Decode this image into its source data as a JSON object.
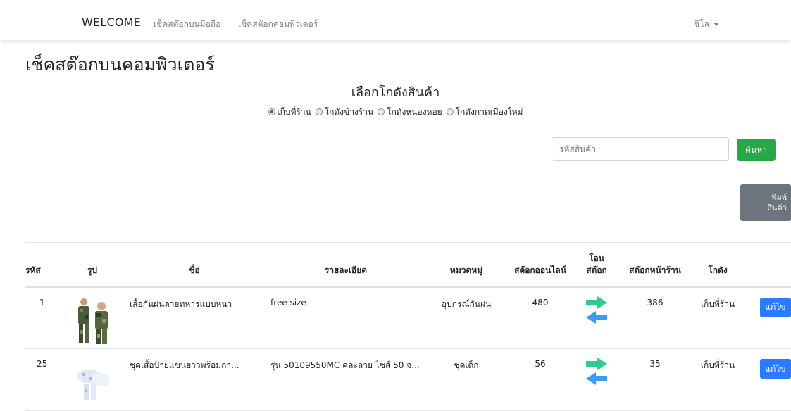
{
  "navbar": {
    "brand": "WELCOME",
    "links": [
      "เช็คสต๊อกบนมือถือ",
      "เช็คสต๊อกคอมพิวเตอร์"
    ],
    "user": "ชิโล"
  },
  "page": {
    "title": "เช็คสต๊อกบนคอมพิวเตอร์",
    "warehouse_heading": "เลือกโกดังสินค้า",
    "warehouses": [
      {
        "label": "เก็บที่ร้าน",
        "checked": true
      },
      {
        "label": "โกดังข้างร้าน",
        "checked": false
      },
      {
        "label": "โกดังหนองหอย",
        "checked": false
      },
      {
        "label": "โกดังกาดเมืองใหม่",
        "checked": false
      }
    ]
  },
  "search": {
    "placeholder": "รหัสสินค้า",
    "button": "ค้นหา"
  },
  "print": {
    "line1": "พิมพ์",
    "line2": "สินค้า"
  },
  "table": {
    "headers": {
      "code": "รหัส",
      "image": "รูป",
      "name": "ชื่อ",
      "detail": "รายละเอียด",
      "category": "หมวดหมู่",
      "online_stock": "สต๊อกออนไลน์",
      "transfer_line1": "โอน",
      "transfer_line2": "สต๊อก",
      "shop_stock": "สต๊อกหน้าร้าน",
      "warehouse": "โกดัง"
    },
    "rows": [
      {
        "code": "1",
        "image_icon": "camouflage-jacket-photo",
        "name": "เสื้อกันฝนลายทหารแบบหนา",
        "detail": "free size",
        "category": "อุปกรณ์กันฝน",
        "online_stock": "480",
        "shop_stock": "386",
        "warehouse": "เก็บที่ร้าน",
        "edit": "แก้ไข"
      },
      {
        "code": "25",
        "image_icon": "baby-clothes-photo",
        "name": "ชุดเสื้อป้ายแขนยาวพร้อมกา...",
        "detail": "รุ่น 50109550MC คละลาย ไซส์ 50 จ...",
        "category": "ชุดเด็ก",
        "online_stock": "56",
        "shop_stock": "35",
        "warehouse": "เก็บที่ร้าน",
        "edit": "แก้ไข"
      }
    ]
  },
  "colors": {
    "green": "#28a745",
    "blue": "#2b7bff",
    "gray": "#6c757d",
    "arrow_right": "#2ecc8f",
    "arrow_left": "#3b9cf5"
  }
}
